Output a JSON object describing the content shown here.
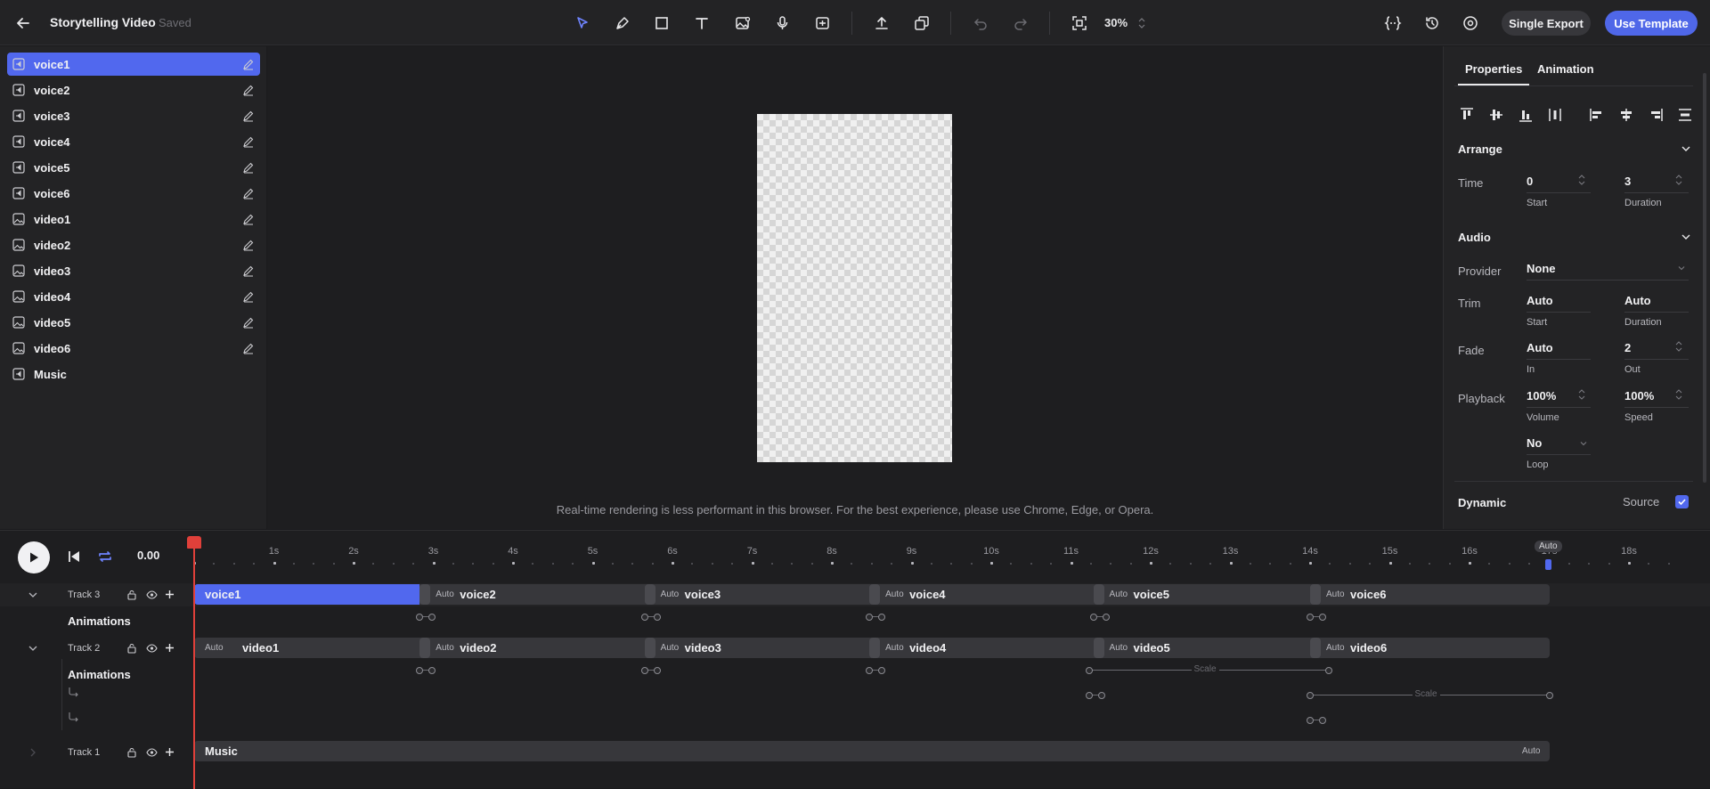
{
  "header": {
    "title": "Storytelling Video",
    "status": "Saved",
    "zoom": "30%",
    "single_export": "Single Export",
    "use_template": "Use Template",
    "tools": [
      "select-tool-icon",
      "pen-tool-icon",
      "shape-tool-icon",
      "text-tool-icon",
      "image-tool-icon",
      "voice-tool-icon",
      "media-tool-icon",
      "upload-icon",
      "duplicate-icon",
      "undo-icon",
      "redo-icon",
      "fit-screen-icon"
    ],
    "right_icons": [
      "code-icon",
      "history-icon",
      "settings-icon"
    ]
  },
  "layers": [
    {
      "name": "voice1",
      "kind": "audio",
      "selected": true
    },
    {
      "name": "voice2",
      "kind": "audio"
    },
    {
      "name": "voice3",
      "kind": "audio"
    },
    {
      "name": "voice4",
      "kind": "audio"
    },
    {
      "name": "voice5",
      "kind": "audio"
    },
    {
      "name": "voice6",
      "kind": "audio"
    },
    {
      "name": "video1",
      "kind": "image"
    },
    {
      "name": "video2",
      "kind": "image"
    },
    {
      "name": "video3",
      "kind": "image"
    },
    {
      "name": "video4",
      "kind": "image"
    },
    {
      "name": "video5",
      "kind": "image"
    },
    {
      "name": "video6",
      "kind": "image"
    },
    {
      "name": "Music",
      "kind": "audio"
    }
  ],
  "canvas": {
    "notice": "Real-time rendering is less performant in this browser. For the best experience, please use Chrome, Edge, or Opera."
  },
  "properties": {
    "tabs": [
      "Properties",
      "Animation"
    ],
    "arrange": {
      "title": "Arrange",
      "time_label": "Time",
      "start": "0",
      "start_label": "Start",
      "duration": "3",
      "duration_label": "Duration"
    },
    "audio": {
      "title": "Audio",
      "provider_label": "Provider",
      "provider": "None",
      "trim_label": "Trim",
      "trim_start": "Auto",
      "trim_start_label": "Start",
      "trim_duration": "Auto",
      "trim_duration_label": "Duration",
      "fade_label": "Fade",
      "fade_in": "Auto",
      "fade_in_label": "In",
      "fade_out": "2",
      "fade_out_label": "Out",
      "playback_label": "Playback",
      "volume": "100%",
      "volume_label": "Volume",
      "speed": "100%",
      "speed_label": "Speed",
      "loop": "No",
      "loop_label": "Loop"
    },
    "dynamic": {
      "title": "Dynamic",
      "source_label": "Source",
      "source_checked": true
    }
  },
  "timeline": {
    "time": "0.00",
    "ruler": [
      "0s",
      "1s",
      "2s",
      "3s",
      "4s",
      "5s",
      "6s",
      "7s",
      "8s",
      "9s",
      "10s",
      "11s",
      "12s",
      "13s",
      "14s",
      "15s",
      "16s",
      "17s",
      "18s"
    ],
    "end_marker": "Auto",
    "tracks": {
      "track3": {
        "label": "Track 3",
        "clips": [
          "voice1",
          "voice2",
          "voice3",
          "voice4",
          "voice5",
          "voice6"
        ],
        "auto": "Auto"
      },
      "track2": {
        "label": "Track 2",
        "clips": [
          "video1",
          "video2",
          "video3",
          "video4",
          "video5",
          "video6"
        ],
        "auto": "Auto"
      },
      "track1": {
        "label": "Track 1",
        "clip": "Music",
        "auto": "Auto"
      }
    },
    "animations_label": "Animations",
    "scale_label": "Scale"
  },
  "colors": {
    "accent": "#5168ee",
    "playhead": "#e0403a"
  }
}
